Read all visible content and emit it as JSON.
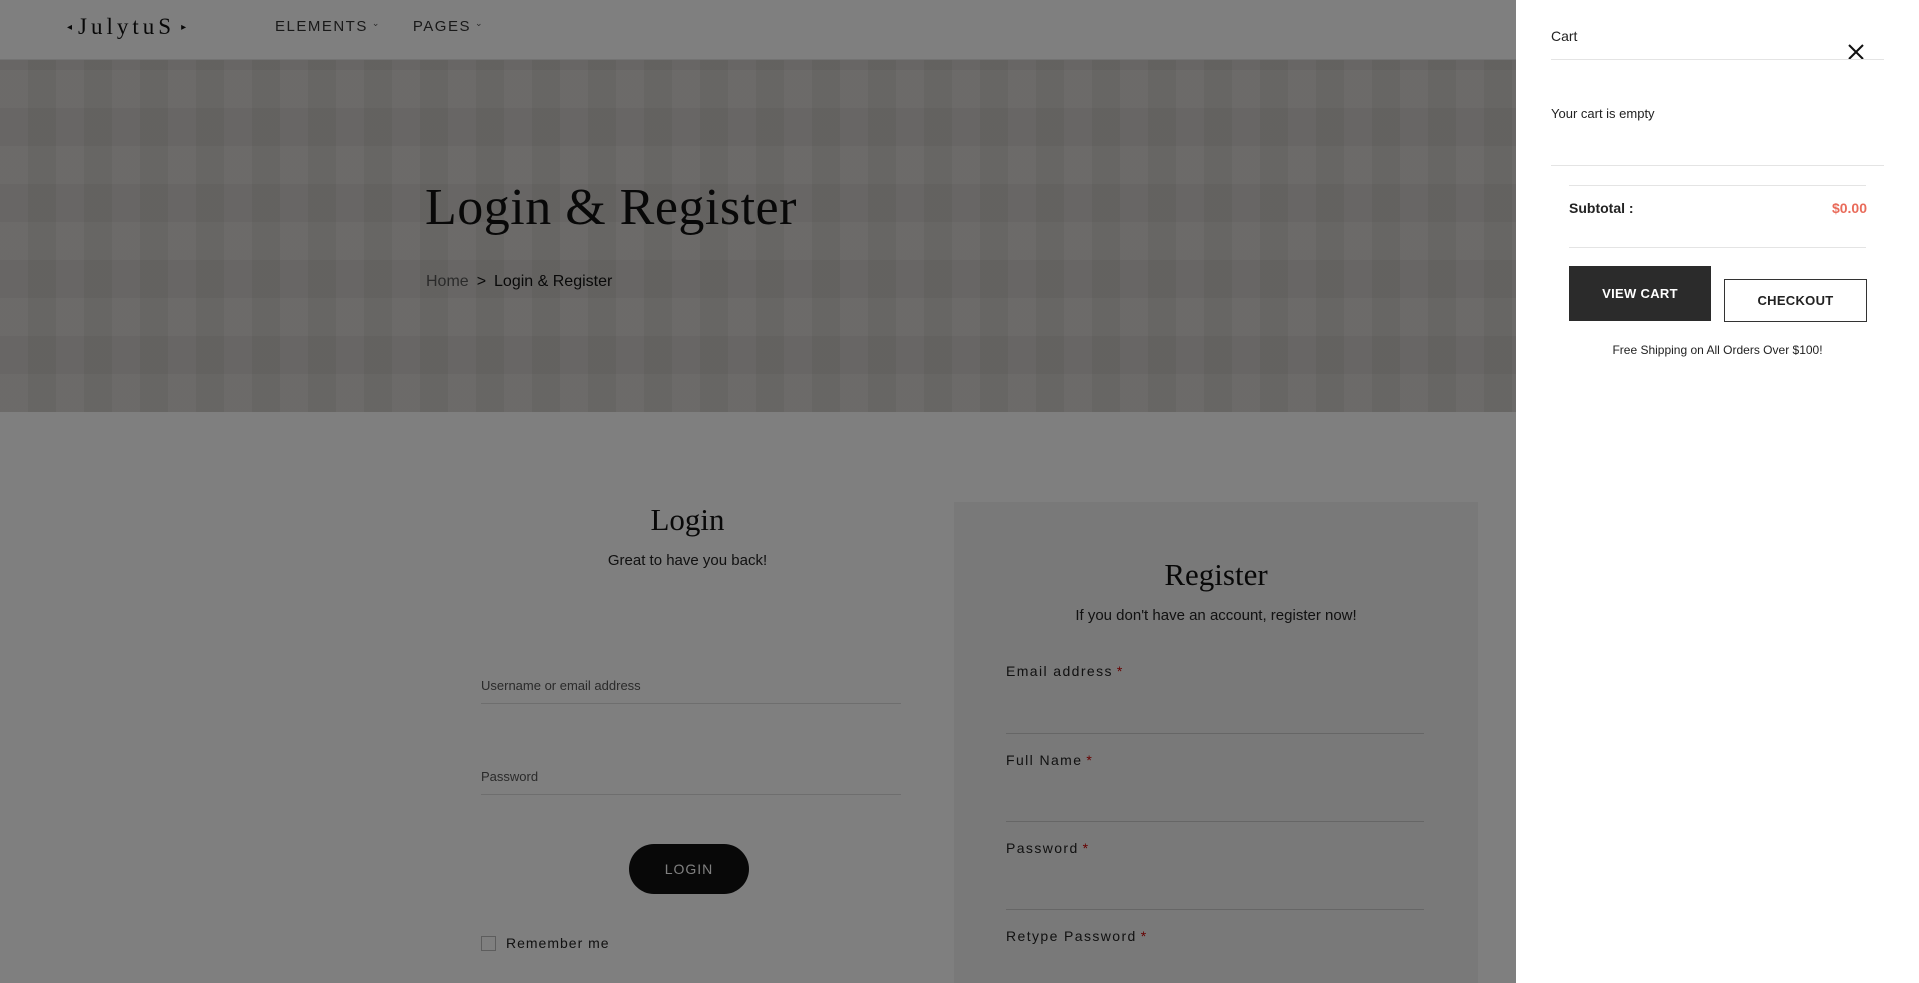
{
  "header": {
    "logo_text": "JulytuS",
    "logo_left_arrow": "◂",
    "logo_right_arrow": "▸",
    "nav": [
      {
        "label": "ELEMENTS"
      },
      {
        "label": "PAGES"
      }
    ]
  },
  "hero": {
    "title": "Login & Register",
    "breadcrumb": {
      "home": "Home",
      "separator": ">",
      "current": "Login & Register"
    }
  },
  "login": {
    "title": "Login",
    "subtitle": "Great to have you back!",
    "username_placeholder": "Username or email address",
    "password_placeholder": "Password",
    "button_label": "LOGIN",
    "remember_label": "Remember me"
  },
  "register": {
    "title": "Register",
    "subtitle": "If you don't have an account, register now!",
    "required_mark": "*",
    "fields": [
      {
        "label": "Email address"
      },
      {
        "label": "Full Name"
      },
      {
        "label": "Password"
      },
      {
        "label": "Retype Password"
      }
    ]
  },
  "cart": {
    "title": "Cart",
    "empty_text": "Your cart is empty",
    "subtotal_label": "Subtotal :",
    "subtotal_value": "$0.00",
    "view_cart_label": "VIEW CART",
    "checkout_label": "CHECKOUT",
    "shipping_note": "Free Shipping on All Orders Over $100!"
  },
  "colors": {
    "overlay": "#000000",
    "accent_price": "#e96b5a",
    "dark_button": "#2b2b2b",
    "required": "#cc0000"
  }
}
